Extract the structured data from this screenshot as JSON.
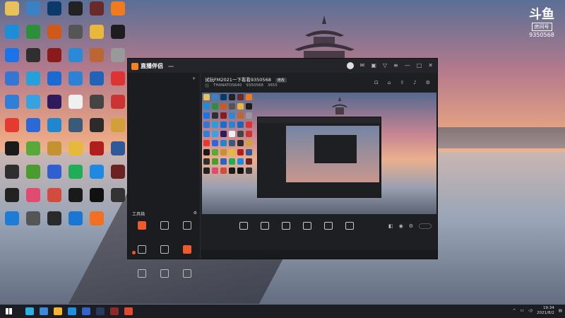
{
  "colors": {
    "accent": "#f58220",
    "hot": "#f05a28",
    "window_bg": "#1e1f22"
  },
  "desktop": {
    "icons": [
      {
        "label": "",
        "color": "#e8c15a"
      },
      {
        "label": "",
        "color": "#3b82c4"
      },
      {
        "label": "",
        "color": "#0a3a6b"
      },
      {
        "label": "",
        "color": "#222"
      },
      {
        "label": "",
        "color": "#6b2a2a"
      },
      {
        "label": "",
        "color": "#f07b1f"
      },
      {
        "label": "",
        "color": "#1a8fd8"
      },
      {
        "label": "",
        "color": "#2c8f3a"
      },
      {
        "label": "",
        "color": "#cf5a18"
      },
      {
        "label": "",
        "color": "#555"
      },
      {
        "label": "",
        "color": "#e9b73a"
      },
      {
        "label": "",
        "color": "#1d1d1d"
      },
      {
        "label": "",
        "color": "#1a73e8"
      },
      {
        "label": "",
        "color": "#2f2f2f"
      },
      {
        "label": "",
        "color": "#8b1a1a"
      },
      {
        "label": "",
        "color": "#2a8ad6"
      },
      {
        "label": "",
        "color": "#bb6633"
      },
      {
        "label": "",
        "color": "#999"
      },
      {
        "label": "",
        "color": "#3575d4"
      },
      {
        "label": "",
        "color": "#26a0da"
      },
      {
        "label": "",
        "color": "#1a6ad4"
      },
      {
        "label": "",
        "color": "#2e82d6"
      },
      {
        "label": "",
        "color": "#2063b8"
      },
      {
        "label": "",
        "color": "#d33"
      },
      {
        "label": "",
        "color": "#2f7fd8"
      },
      {
        "label": "",
        "color": "#35a3e0"
      },
      {
        "label": "",
        "color": "#2e1b5c"
      },
      {
        "label": "",
        "color": "#f0f0f0"
      },
      {
        "label": "",
        "color": "#444"
      },
      {
        "label": "",
        "color": "#c33"
      },
      {
        "label": "",
        "color": "#e43a2f"
      },
      {
        "label": "",
        "color": "#2a6ad8"
      },
      {
        "label": "",
        "color": "#1f86d0"
      },
      {
        "label": "",
        "color": "#385b7a"
      },
      {
        "label": "",
        "color": "#2b2b2b"
      },
      {
        "label": "",
        "color": "#d1a03a"
      },
      {
        "label": "",
        "color": "#1a1a1a"
      },
      {
        "label": "",
        "color": "#58a93a"
      },
      {
        "label": "",
        "color": "#c49230"
      },
      {
        "label": "",
        "color": "#e5b93a"
      },
      {
        "label": "",
        "color": "#b01e1e"
      },
      {
        "label": "",
        "color": "#2e5a9a"
      },
      {
        "label": "",
        "color": "#2e2e2e"
      },
      {
        "label": "",
        "color": "#4a9c2f"
      },
      {
        "label": "",
        "color": "#2f5fd0"
      },
      {
        "label": "",
        "color": "#1fae56"
      },
      {
        "label": "",
        "color": "#1e88e5"
      },
      {
        "label": "",
        "color": "#6b2222"
      },
      {
        "label": "",
        "color": "#222"
      },
      {
        "label": "",
        "color": "#e34a6f"
      },
      {
        "label": "",
        "color": "#d24b3c"
      },
      {
        "label": "",
        "color": "#1a1a1a"
      },
      {
        "label": "",
        "color": "#111"
      },
      {
        "label": "",
        "color": "#333"
      },
      {
        "label": "",
        "color": "#1d7cd6"
      },
      {
        "label": "",
        "color": "#555"
      },
      {
        "label": "",
        "color": "#2a2a2a"
      },
      {
        "label": "",
        "color": "#1976d2"
      },
      {
        "label": "",
        "color": "#f37021"
      },
      {
        "label": "",
        "color": "#00000000"
      }
    ]
  },
  "overlay": {
    "brand_mark": "斗鱼",
    "room_label": "房间号",
    "room_number": "9350568"
  },
  "chat": [
    {
      "text": "",
      "cls": ""
    },
    {
      "text": "",
      "cls": ""
    },
    {
      "text": "",
      "cls": ""
    },
    {
      "text": "",
      "cls": "red"
    },
    {
      "text": "",
      "cls": ""
    },
    {
      "text": "",
      "cls": ""
    },
    {
      "text": "",
      "cls": ""
    },
    {
      "text": "",
      "cls": ""
    },
    {
      "text": "",
      "cls": ""
    },
    {
      "text": "",
      "cls": "blue"
    },
    {
      "text": "",
      "cls": ""
    },
    {
      "text": "",
      "cls": ""
    }
  ],
  "app": {
    "title": "直播伴侣",
    "version": "",
    "tabs": [
      {
        "label": "",
        "active": true
      },
      {
        "label": "",
        "active": false
      },
      {
        "label": "",
        "active": false
      }
    ],
    "scenes": [
      "",
      "",
      ""
    ],
    "tools_title": "工具箱",
    "tools": [
      {
        "label": "",
        "hot": true
      },
      {
        "label": "",
        "hot": false
      },
      {
        "label": "",
        "hot": false
      },
      {
        "label": "",
        "hot": false
      },
      {
        "label": "",
        "hot": false
      },
      {
        "label": "",
        "hot": true
      },
      {
        "label": "",
        "hot": false
      },
      {
        "label": "",
        "hot": false
      },
      {
        "label": "",
        "hot": false
      }
    ],
    "notice": "",
    "room_title": "试玩FM2021一下看看9350568",
    "edit_label": "修改",
    "meta_tag": "",
    "streamer": "THANATOS640",
    "room_id": "9350568",
    "heat": "3655",
    "controls": [
      {
        "label": ""
      },
      {
        "label": ""
      },
      {
        "label": ""
      },
      {
        "label": ""
      },
      {
        "label": ""
      },
      {
        "label": ""
      }
    ],
    "start_label": "",
    "status_items": [
      "",
      "",
      ""
    ],
    "status_right": ""
  },
  "taskbar": {
    "icons": [
      "#2bb0e6",
      "#3b8ad8",
      "#f5b52e",
      "#1e8fe0",
      "#3463c9",
      "#2a3a5c",
      "#8c2a2a",
      "#e24a2d"
    ],
    "time": "19:34",
    "date": "2021/8/2"
  }
}
